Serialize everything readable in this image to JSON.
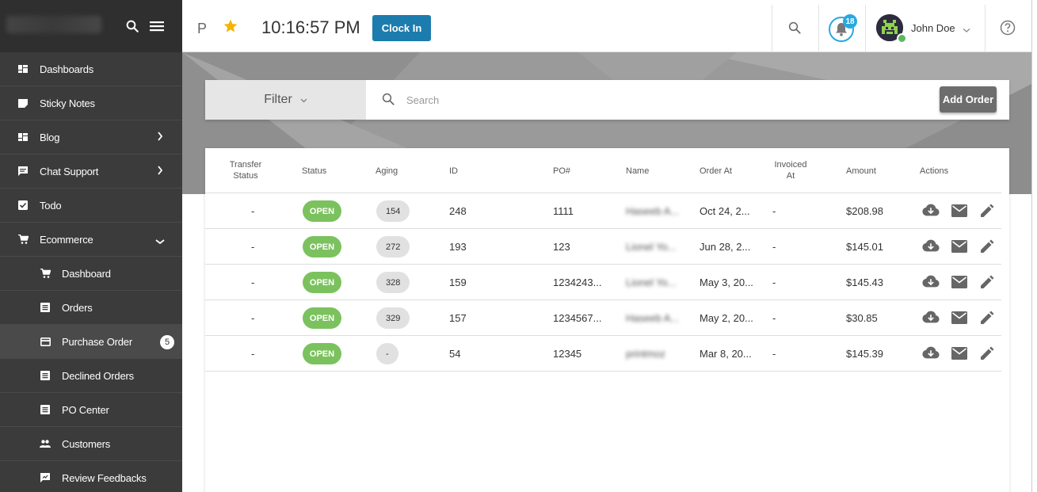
{
  "sidebar": {
    "items": [
      {
        "label": "Dashboards",
        "icon": "dashboard-icon"
      },
      {
        "label": "Sticky Notes",
        "icon": "note-icon"
      },
      {
        "label": "Blog",
        "icon": "blog-icon"
      },
      {
        "label": "Chat Support",
        "icon": "chat-icon"
      },
      {
        "label": "Todo",
        "icon": "checkbox-icon"
      },
      {
        "label": "Ecommerce",
        "icon": "cart-icon"
      }
    ],
    "sub_items": [
      {
        "label": "Dashboard",
        "icon": "cart-icon"
      },
      {
        "label": "Orders",
        "icon": "list-icon"
      },
      {
        "label": "Purchase Order",
        "icon": "card-icon",
        "badge": "5"
      },
      {
        "label": "Declined Orders",
        "icon": "list-icon"
      },
      {
        "label": "PO Center",
        "icon": "list-icon"
      },
      {
        "label": "Customers",
        "icon": "people-icon"
      },
      {
        "label": "Review Feedbacks",
        "icon": "feedback-icon"
      }
    ]
  },
  "header": {
    "p_letter": "P",
    "time": "10:16:57 PM",
    "clock_in_label": "Clock In",
    "notification_count": "18",
    "user_name": "John Doe"
  },
  "filterbar": {
    "filter_label": "Filter",
    "search_placeholder": "Search",
    "add_order_label": "Add Order"
  },
  "table": {
    "columns": {
      "transfer_status": "Transfer Status",
      "status": "Status",
      "aging": "Aging",
      "id": "ID",
      "po": "PO#",
      "name": "Name",
      "order_at": "Order At",
      "invoiced_at": "Invoiced At",
      "amount": "Amount",
      "actions": "Actions"
    },
    "rows": [
      {
        "transfer": "-",
        "status": "OPEN",
        "aging": "154",
        "id": "248",
        "po": "1111",
        "name": "Haseeb A...",
        "order_at": "Oct 24, 2...",
        "invoiced": "-",
        "amount": "$208.98"
      },
      {
        "transfer": "-",
        "status": "OPEN",
        "aging": "272",
        "id": "193",
        "po": "123",
        "name": "Lionel Yo...",
        "order_at": "Jun 28, 2...",
        "invoiced": "-",
        "amount": "$145.01"
      },
      {
        "transfer": "-",
        "status": "OPEN",
        "aging": "328",
        "id": "159",
        "po": "1234243...",
        "name": "Lionel Yo...",
        "order_at": "May 3, 20...",
        "invoiced": "-",
        "amount": "$145.43"
      },
      {
        "transfer": "-",
        "status": "OPEN",
        "aging": "329",
        "id": "157",
        "po": "1234567...",
        "name": "Haseeb A...",
        "order_at": "May 2, 20...",
        "invoiced": "-",
        "amount": "$30.85"
      },
      {
        "transfer": "-",
        "status": "OPEN",
        "aging": "-",
        "id": "54",
        "po": "12345",
        "name": "printmoz",
        "order_at": "Mar 8, 20...",
        "invoiced": "-",
        "amount": "$145.39"
      }
    ]
  },
  "colors": {
    "sidebar_bg": "#3b3b3b",
    "accent_blue": "#1c7cad",
    "open_green": "#7bc25e",
    "star_gold": "#f5b300"
  }
}
